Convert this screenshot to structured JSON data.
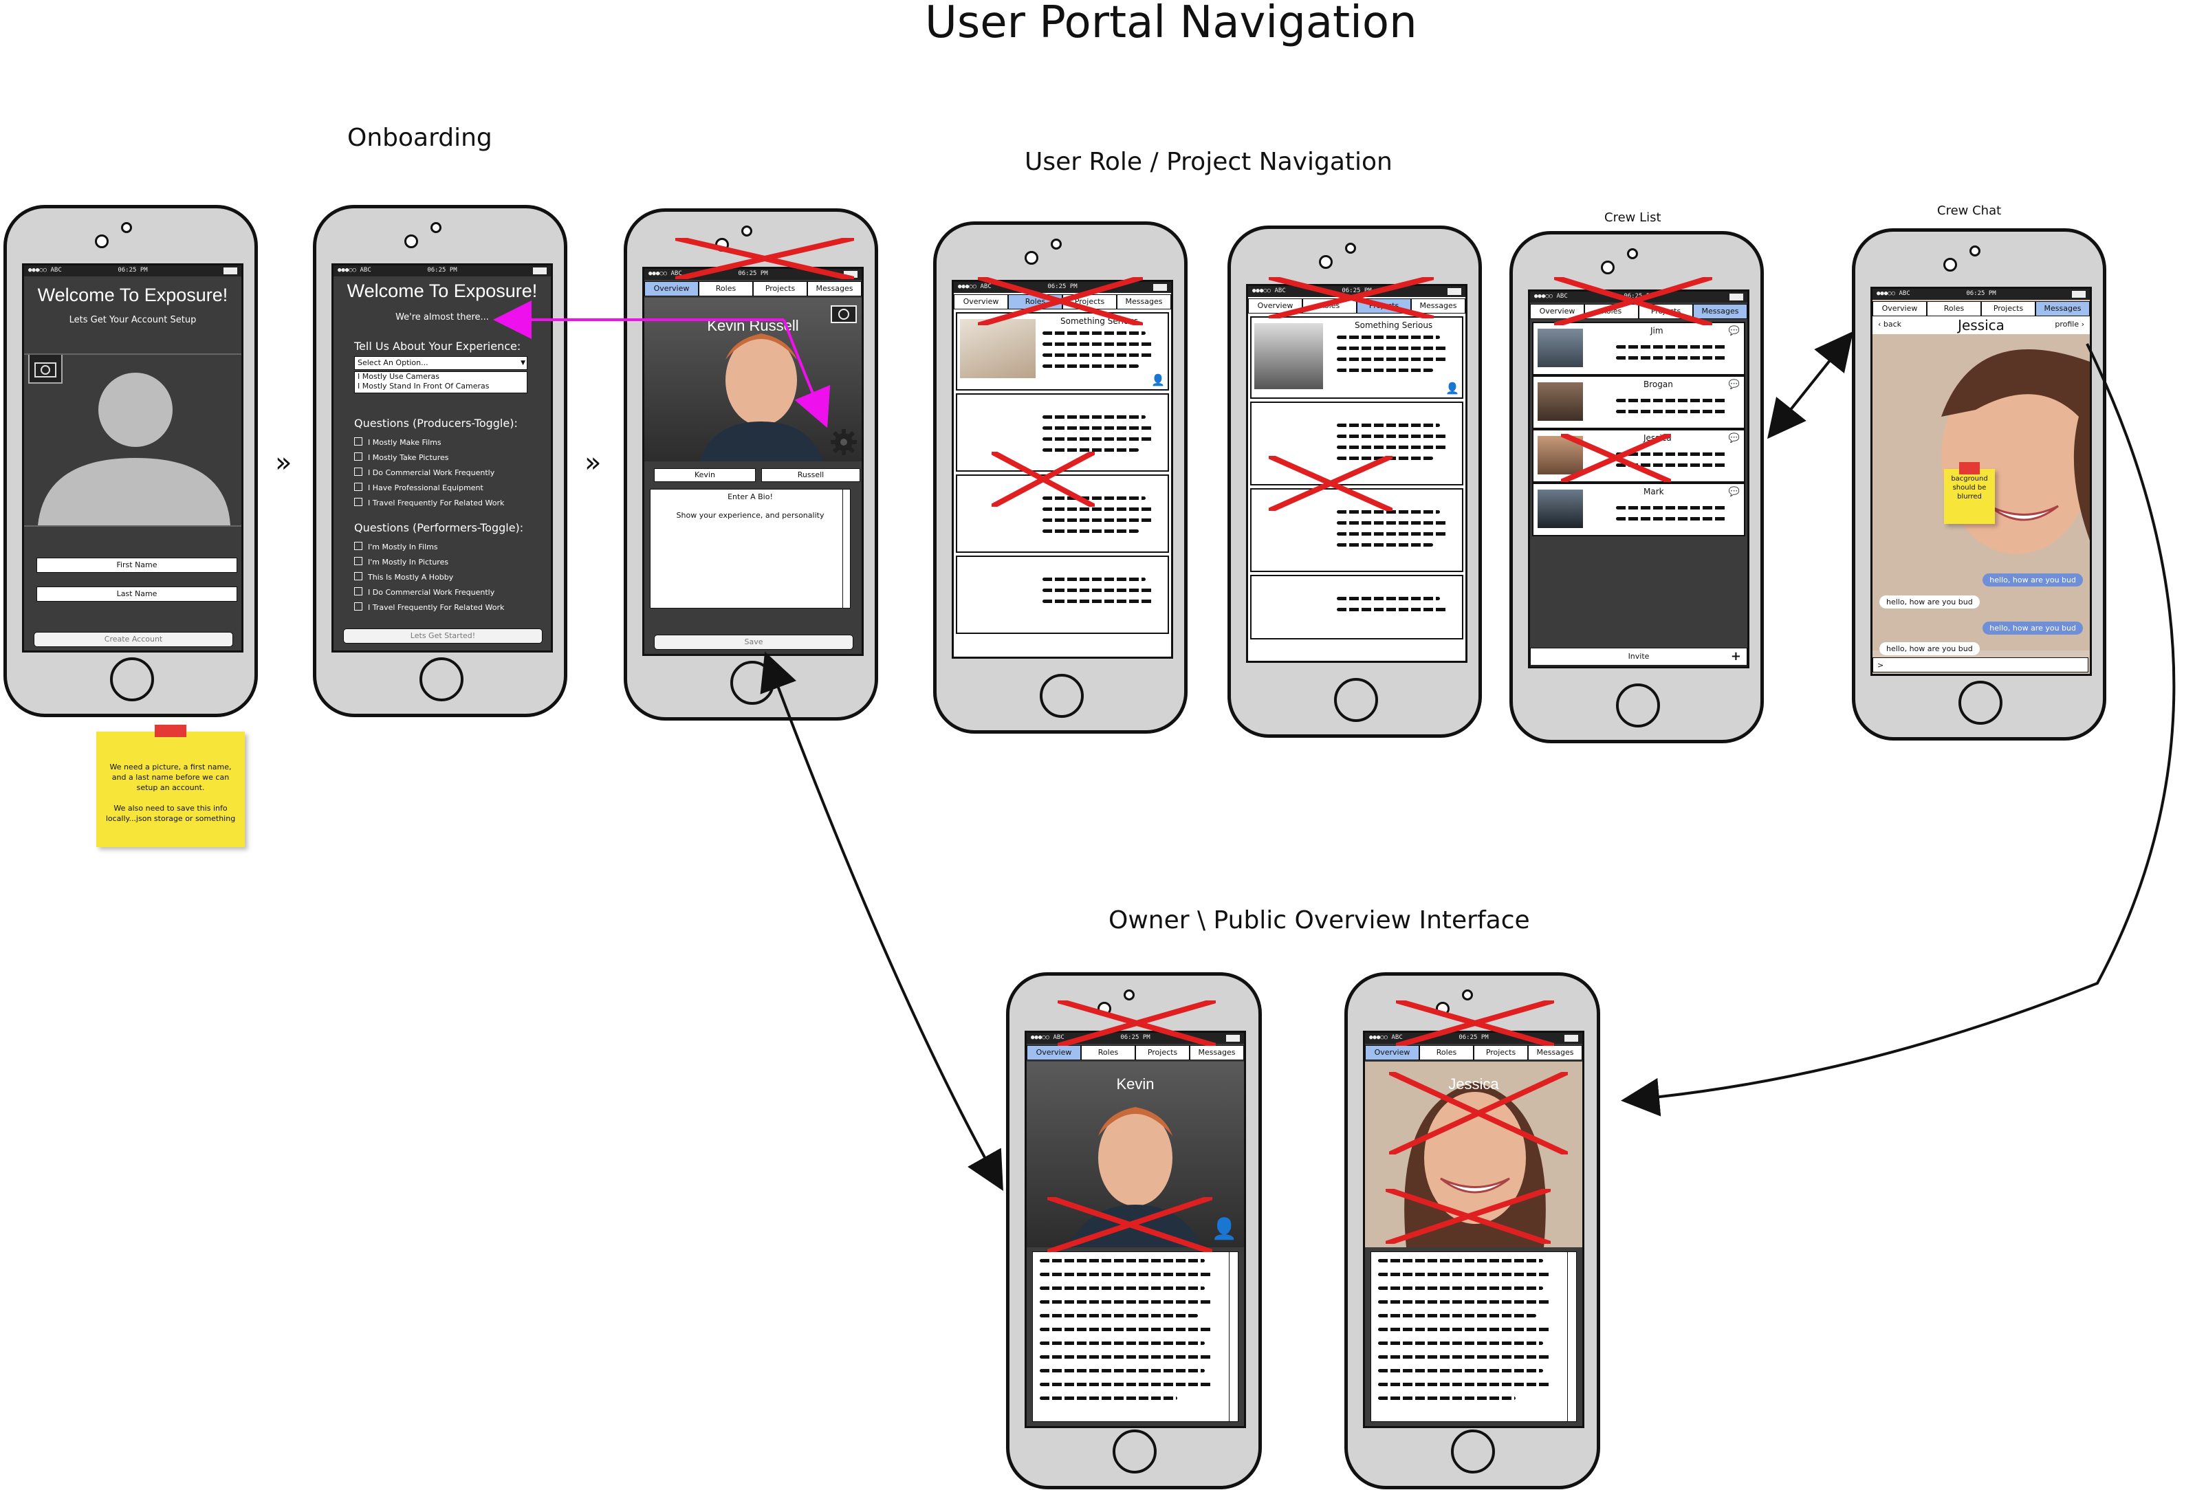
{
  "title": "User Portal Navigation",
  "sections": {
    "onboarding": "Onboarding",
    "role_nav": "User Role / Project Navigation",
    "crew_list": "Crew List",
    "crew_chat": "Crew Chat",
    "owner_public": "Owner \\ Public Overview Interface"
  },
  "status": {
    "carrier": "●●●○○ ABC",
    "time": "06:25 PM"
  },
  "tabs": {
    "overview": "Overview",
    "roles": "Roles",
    "projects": "Projects",
    "messages": "Messages"
  },
  "screen1": {
    "title": "Welcome To Exposure!",
    "subtitle": "Lets Get Your Account Setup",
    "first_name": "First Name",
    "last_name": "Last Name",
    "create_account": "Create Account"
  },
  "screen2": {
    "title": "Welcome To Exposure!",
    "subtitle": "We're almost there...",
    "experience_label": "Tell Us About Your Experience:",
    "select_placeholder": "Select An Option...",
    "options": [
      "I Mostly Use Cameras",
      "I Mostly Stand In Front Of Cameras"
    ],
    "producers_label": "Questions (Producers-Toggle):",
    "producers": [
      "I Mostly Make Films",
      "I Mostly Take Pictures",
      "I Do Commercial Work Frequently",
      "I Have Professional Equipment",
      "I Travel Frequently For Related Work"
    ],
    "performers_label": "Questions (Performers-Toggle):",
    "performers": [
      "I'm Mostly In Films",
      "I'm Mostly In Pictures",
      "This Is Mostly A Hobby",
      "I Do Commercial Work Frequently",
      "I Travel Frequently For Related Work"
    ],
    "start_button": "Lets Get Started!"
  },
  "screen3": {
    "name": "Kevin Russell",
    "first": "Kevin",
    "last": "Russell",
    "bio_title": "Enter A Bio!",
    "bio_hint": "Show  your experience, and personality",
    "save": "Save"
  },
  "roles_screen": {
    "card_title": "Something Serious"
  },
  "crew": {
    "members": [
      "Jim",
      "Brogan",
      "Jessica",
      "Mark"
    ],
    "invite": "Invite"
  },
  "chat": {
    "back": "back",
    "name": "Jessica",
    "profile": "profile",
    "note": "bacground should be blurred",
    "messages": [
      {
        "dir": "out",
        "text": "hello, how are you bud"
      },
      {
        "dir": "in",
        "text": "hello, how are you bud"
      },
      {
        "dir": "out",
        "text": "hello, how are you bud"
      },
      {
        "dir": "in",
        "text": "hello, how are you bud"
      }
    ],
    "input": ">"
  },
  "overview": {
    "kevin": "Kevin",
    "jessica": "Jessica"
  },
  "sticky_note": "We need a picture, a first name, and a last name before we can setup an account.\n\nWe also need to save this info locally...json storage or something",
  "colors": {
    "accent_tab": "#9fbff0",
    "cross": "#e02020",
    "arrow_magenta": "#ee11ee",
    "note": "#f8e53a"
  }
}
